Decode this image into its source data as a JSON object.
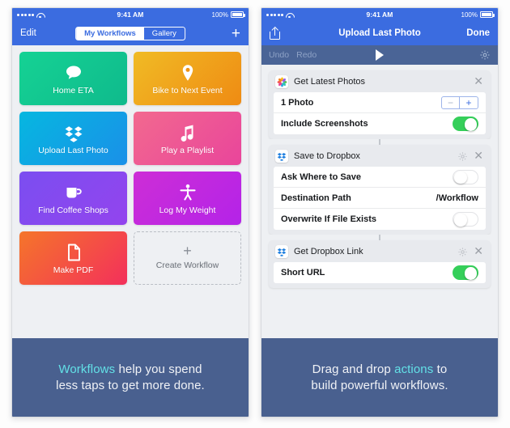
{
  "left_phone": {
    "status_bar": {
      "time": "9:41 AM",
      "battery_pct": "100%",
      "signal_dots": 5,
      "wifi_icon": "wifi-icon",
      "battery_icon": "battery-icon"
    },
    "nav": {
      "edit_label": "Edit",
      "add_icon": "plus-icon",
      "segments": [
        {
          "label": "My Workflows",
          "selected": true
        },
        {
          "label": "Gallery",
          "selected": false
        }
      ]
    },
    "tiles": [
      {
        "label": "Home ETA",
        "icon": "speech-bubble-icon"
      },
      {
        "label": "Bike to Next Event",
        "icon": "map-pin-icon"
      },
      {
        "label": "Upload Last Photo",
        "icon": "dropbox-icon"
      },
      {
        "label": "Play a Playlist",
        "icon": "music-note-icon"
      },
      {
        "label": "Find Coffee Shops",
        "icon": "coffee-mug-icon"
      },
      {
        "label": "Log My Weight",
        "icon": "person-icon"
      },
      {
        "label": "Make PDF",
        "icon": "document-icon"
      },
      {
        "label": "Create Workflow",
        "icon": "plus-icon"
      }
    ],
    "caption": {
      "highlight": "Workflows",
      "rest": " help you spend",
      "line2": "less taps to get more done."
    }
  },
  "right_phone": {
    "status_bar": {
      "time": "9:41 AM",
      "battery_pct": "100%",
      "signal_dots": 5,
      "wifi_icon": "wifi-icon",
      "battery_icon": "battery-icon"
    },
    "nav": {
      "share_icon": "share-icon",
      "title": "Upload Last Photo",
      "done_label": "Done"
    },
    "toolbar": {
      "undo_label": "Undo",
      "redo_label": "Redo",
      "run_icon": "play-icon",
      "settings_icon": "gear-icon"
    },
    "cards": [
      {
        "title": "Get Latest Photos",
        "app_icon": "photos-icon",
        "has_gear": false,
        "close_icon": "close-icon",
        "rows": [
          {
            "label": "1 Photo",
            "control": "stepper",
            "minus": "−",
            "plus": "+"
          },
          {
            "label": "Include Screenshots",
            "control": "toggle",
            "value": "on"
          }
        ]
      },
      {
        "title": "Save to Dropbox",
        "app_icon": "dropbox-icon",
        "has_gear": true,
        "gear_icon": "gear-icon",
        "close_icon": "close-icon",
        "rows": [
          {
            "label": "Ask Where to Save",
            "control": "toggle",
            "value": "off"
          },
          {
            "label": "Destination Path",
            "control": "text",
            "value": "/Workflow"
          },
          {
            "label": "Overwrite If File Exists",
            "control": "toggle",
            "value": "off"
          }
        ]
      },
      {
        "title": "Get Dropbox Link",
        "app_icon": "dropbox-icon",
        "has_gear": true,
        "gear_icon": "gear-icon",
        "close_icon": "close-icon",
        "rows": [
          {
            "label": "Short URL",
            "control": "toggle",
            "value": "on"
          }
        ]
      }
    ],
    "caption": {
      "pre": "Drag and drop ",
      "highlight": "actions",
      "post": " to",
      "line2": "build powerful workflows."
    }
  },
  "colors": {
    "ios_blue": "#3b6ce0",
    "toolbar_blue": "#4a6496",
    "caption_bg": "#49608f",
    "caption_highlight": "#62e0e6",
    "toggle_on": "#35cf5a",
    "page_bg": "#eef0f3"
  }
}
